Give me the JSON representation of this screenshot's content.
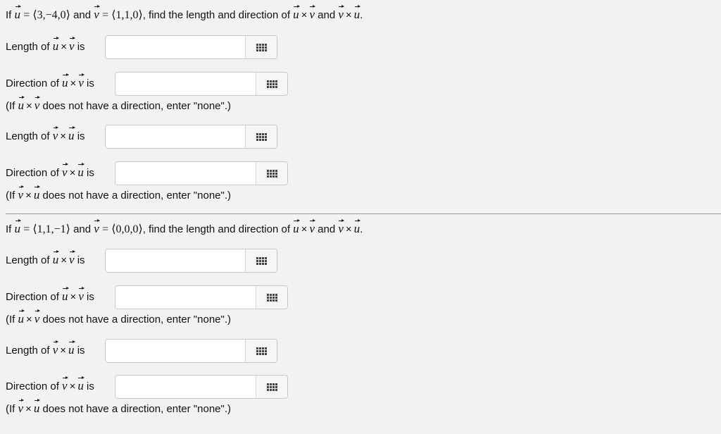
{
  "problems": [
    {
      "u": "⟨3,−4,0⟩",
      "v": "⟨1,1,0⟩",
      "header_if": "If",
      "header_and": "and",
      "header_find": ", find the length and direction of",
      "header_and2": "and",
      "fields": [
        {
          "prefix": "Length of",
          "suffix": "is",
          "value": ""
        },
        {
          "prefix": "Direction of",
          "suffix": "is",
          "value": "",
          "note_prefix": "(If",
          "note_suffix": "does not have a direction, enter \"none\".)"
        },
        {
          "prefix": "Length of",
          "suffix": "is",
          "value": ""
        },
        {
          "prefix": "Direction of",
          "suffix": "is",
          "value": "",
          "note_prefix": "(If",
          "note_suffix": "does not have a direction, enter \"none\".)"
        }
      ]
    },
    {
      "u": "⟨1,1,−1⟩",
      "v": "⟨0,0,0⟩",
      "header_if": "If",
      "header_and": "and",
      "header_find": ", find the length and direction of",
      "header_and2": "and",
      "fields": [
        {
          "prefix": "Length of",
          "suffix": "is",
          "value": ""
        },
        {
          "prefix": "Direction of",
          "suffix": "is",
          "value": "",
          "note_prefix": "(If",
          "note_suffix": "does not have a direction, enter \"none\".)"
        },
        {
          "prefix": "Length of",
          "suffix": "is",
          "value": ""
        },
        {
          "prefix": "Direction of",
          "suffix": "is",
          "value": "",
          "note_prefix": "(If",
          "note_suffix": "does not have a direction, enter \"none\".)"
        }
      ]
    }
  ],
  "symbols": {
    "u": "u",
    "v": "v",
    "times": "×",
    "equals": "=",
    "period": "."
  },
  "icons": {
    "palette": "grid-icon"
  }
}
